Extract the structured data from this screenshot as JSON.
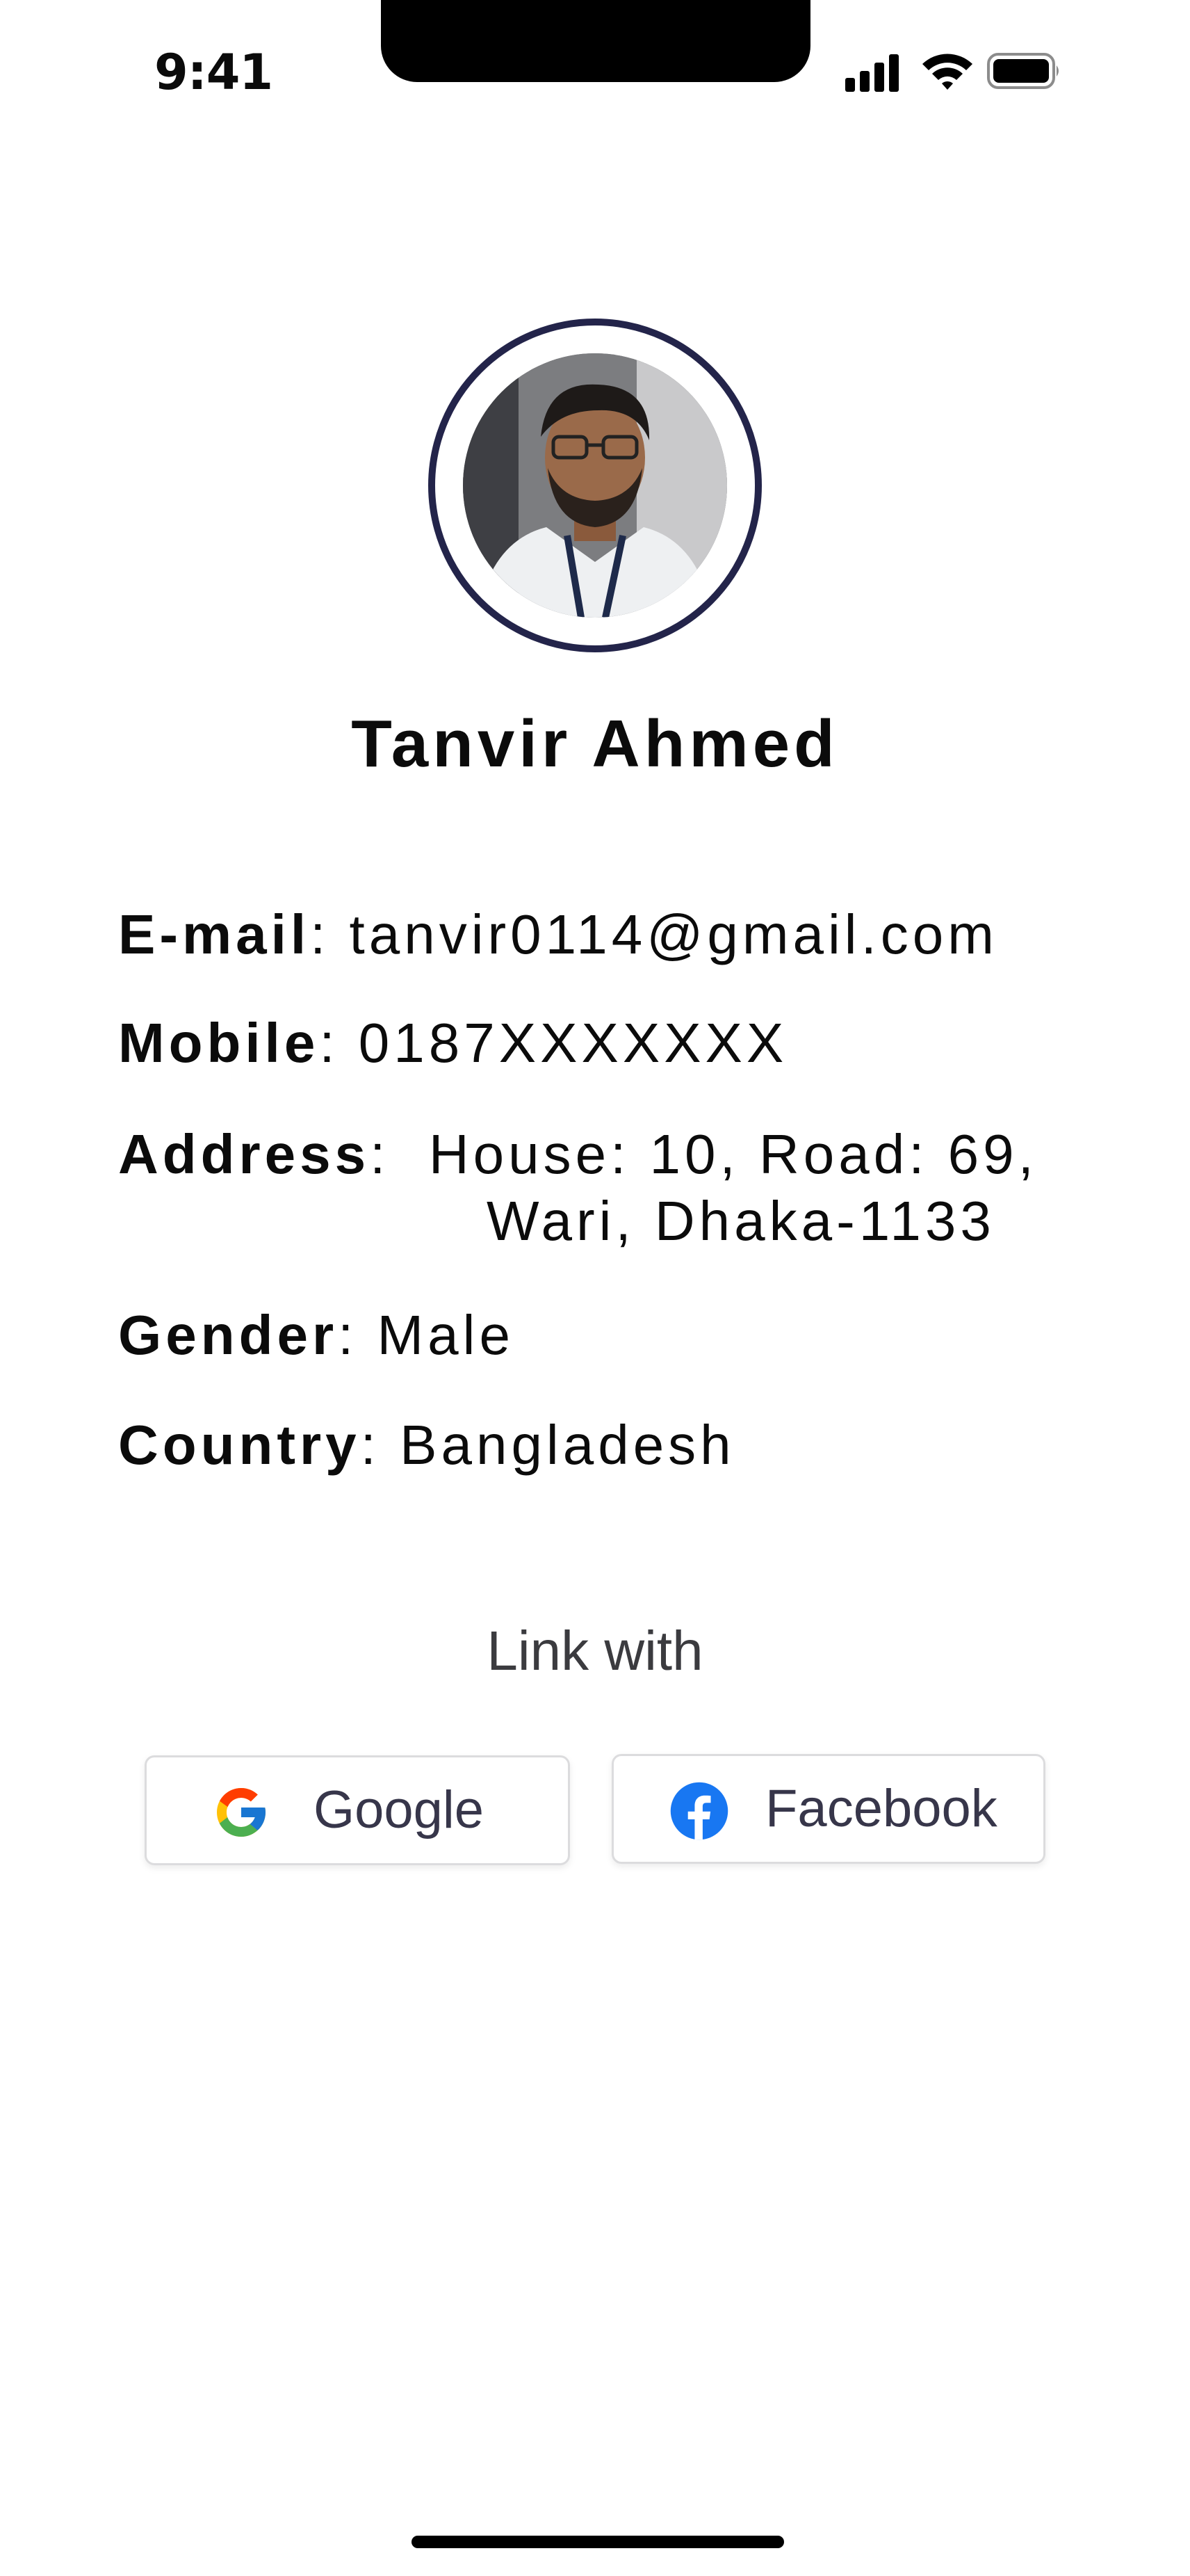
{
  "status_bar": {
    "time": "9:41",
    "icons": [
      "signal-icon",
      "wifi-icon",
      "battery-icon"
    ]
  },
  "profile": {
    "name": "Tanvir Ahmed",
    "avatar_ring_color": "#23244a"
  },
  "details": {
    "email": {
      "label": "E-mail",
      "value": "tanvir0114@gmail.com"
    },
    "mobile": {
      "label": "Mobile",
      "value": "0187XXXXXXX"
    },
    "address": {
      "label": "Address",
      "line1": "House: 10, Road: 69,",
      "line2": "Wari, Dhaka-1133"
    },
    "gender": {
      "label": "Gender",
      "value": "Male"
    },
    "country": {
      "label": "Country",
      "value": "Bangladesh"
    }
  },
  "link_with": {
    "heading": "Link with",
    "google": {
      "label": "Google",
      "icon": "google-icon"
    },
    "facebook": {
      "label": "Facebook",
      "icon": "facebook-icon",
      "color": "#1877f2"
    }
  }
}
